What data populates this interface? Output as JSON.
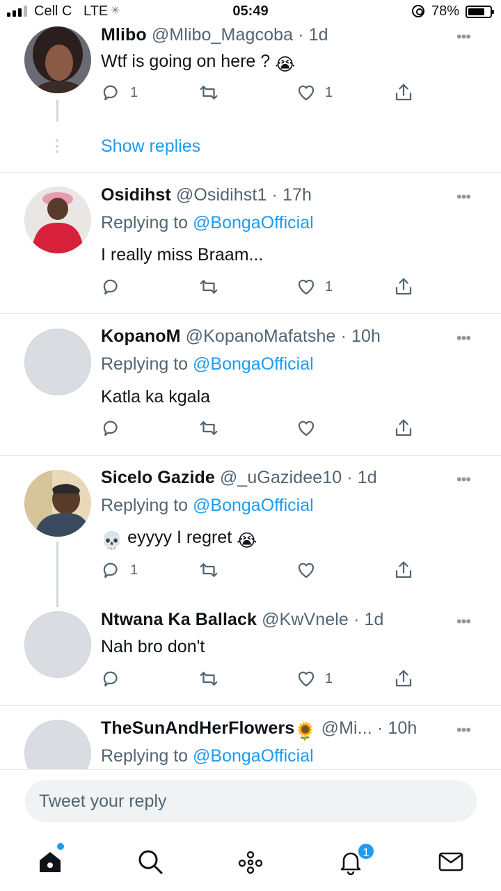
{
  "status_bar": {
    "carrier": "Cell C",
    "network": "LTE",
    "time": "05:49",
    "battery_percent": "78%",
    "battery_level": 0.78
  },
  "tweets": [
    {
      "name": "Mlibo",
      "handle": "@Mlibo_Magcoba",
      "time": "· 1d",
      "text": "Wtf is going on here ?",
      "text_emoji": "😭",
      "reply_count": "1",
      "like_count": "1",
      "show_replies": "Show replies"
    },
    {
      "name": "Osidihst",
      "handle": "@Osidihst1",
      "time": "· 17h",
      "replying_prefix": "Replying to",
      "replying_to": "@BongaOfficial",
      "text": "I really miss Braam...",
      "reply_count": "",
      "like_count": "1"
    },
    {
      "name": "KopanoM",
      "handle": "@KopanoMafatshe",
      "time": "· 10h",
      "replying_prefix": "Replying to",
      "replying_to": "@BongaOfficial",
      "text": "Katla ka kgala",
      "reply_count": "",
      "like_count": ""
    },
    {
      "name": "Sicelo Gazide",
      "handle": "@_uGazidee10",
      "time": "· 1d",
      "replying_prefix": "Replying to",
      "replying_to": "@BongaOfficial",
      "text_emoji_lead": "💀",
      "text": "eyyyy I regret",
      "text_emoji": "😭",
      "reply_count": "1",
      "like_count": ""
    },
    {
      "name": "Ntwana Ka Ballack",
      "handle": "@KwVnele",
      "time": "· 1d",
      "text": "Nah bro don't",
      "reply_count": "",
      "like_count": "1"
    },
    {
      "name": "TheSunAndHerFlowers",
      "name_emoji": "🌻",
      "handle": "@Mi...",
      "time": "· 10h",
      "replying_prefix": "Replying to",
      "replying_to": "@BongaOfficial"
    }
  ],
  "more_glyph": "•••",
  "reply_box": {
    "placeholder": "Tweet your reply"
  },
  "nav": {
    "icons": [
      "home-icon",
      "search-icon",
      "spaces-icon",
      "notifications-icon",
      "messages-icon"
    ],
    "notification_badge": "1"
  },
  "colors": {
    "accent": "#1d9bf0",
    "text": "#0f1419",
    "secondary": "#536471"
  }
}
